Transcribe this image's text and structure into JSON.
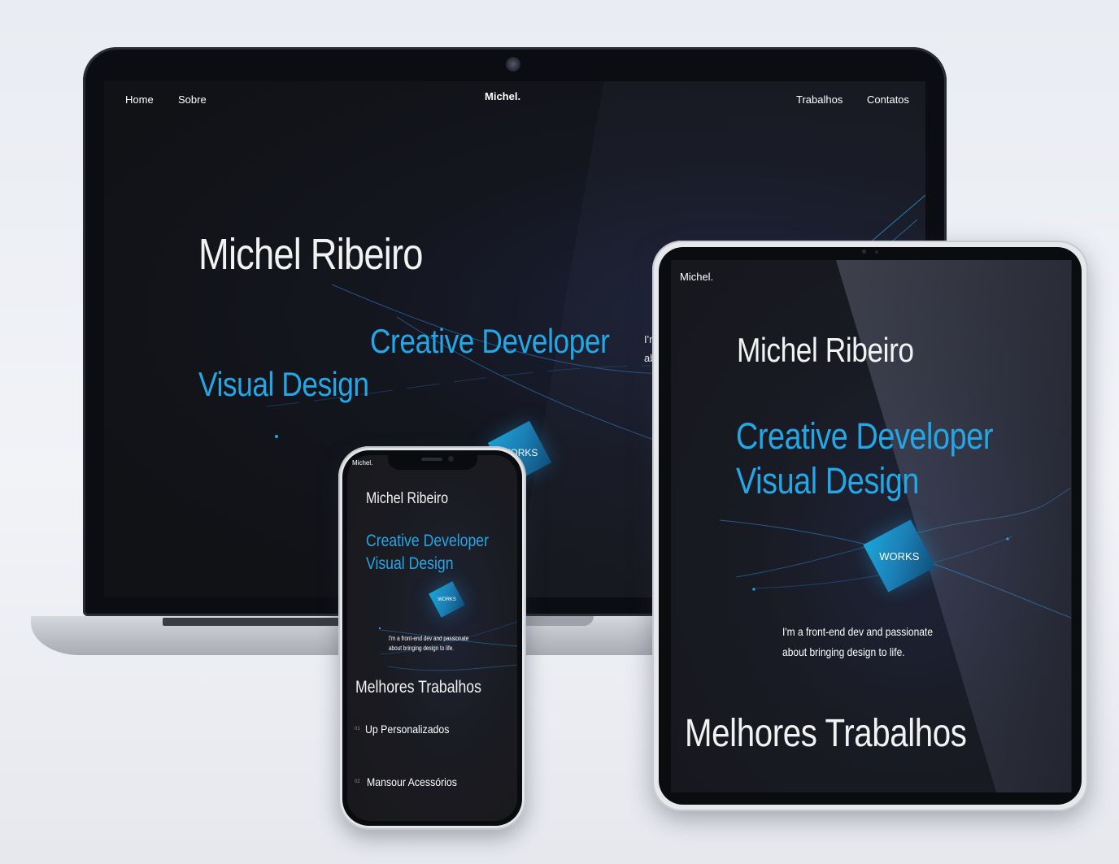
{
  "laptop": {
    "nav": {
      "home": "Home",
      "sobre": "Sobre",
      "brand": "Michel.",
      "trabalhos": "Trabalhos",
      "contatos": "Contatos"
    },
    "hero": {
      "name": "Michel Ribeiro",
      "role_1": "Creative Developer",
      "role_2": "Visual Design",
      "tagline_partial_1": "I'r",
      "tagline_partial_2": "ab"
    },
    "works_badge": "WORKS"
  },
  "tablet": {
    "brand": "Michel.",
    "hero": {
      "name": "Michel Ribeiro",
      "role_1": "Creative Developer",
      "role_2": "Visual Design",
      "tagline_line_1": "I'm a front-end dev and passionate",
      "tagline_line_2": "about bringing design to life."
    },
    "works_badge": "WORKS",
    "section_title": "Melhores Trabalhos"
  },
  "phone": {
    "brand": "Michel.",
    "hero": {
      "name": "Michel Ribeiro",
      "role_1": "Creative Developer",
      "role_2": "Visual Design",
      "tagline_line_1": "I'm a front-end dev and passionate",
      "tagline_line_2": "about bringing design to life."
    },
    "works_badge": "WORKS",
    "section_title": "Melhores Trabalhos",
    "works": [
      {
        "num": "01",
        "title": "Up Personalizados"
      },
      {
        "num": "02",
        "title": "Mansour Acessórios"
      }
    ]
  },
  "colors": {
    "accent": "#23a7e6",
    "screen_bg": "#111216",
    "page_bg": "#e9ecf2"
  }
}
